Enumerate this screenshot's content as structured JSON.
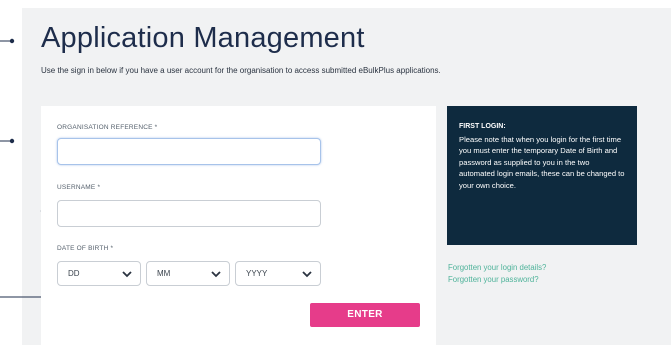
{
  "page": {
    "title": "Application Management",
    "subtitle": "Use the sign in below if you have a user account for the organisation to access submitted eBulkPlus applications."
  },
  "form": {
    "org_ref_label": "ORGANISATION REFERENCE *",
    "org_ref_value": "",
    "username_label": "USERNAME *",
    "username_value": "",
    "dob_label": "DATE OF BIRTH *",
    "dob_day": "DD",
    "dob_month": "MM",
    "dob_year": "YYYY",
    "enter_label": "ENTER"
  },
  "info": {
    "heading": "FIRST LOGIN:",
    "text": "Please note that when you login for the first time you must enter the temporary Date of Birth and password as supplied to you in the two automated login emails, these can be changed to your own choice."
  },
  "links": {
    "forgot_login": "Forgotten your login details?",
    "forgot_password": "Forgotten your password?"
  },
  "colors": {
    "accent": "#e63c8a",
    "info_bg": "#0e2a3e",
    "link": "#4fb39a",
    "title": "#1e2d4b"
  }
}
